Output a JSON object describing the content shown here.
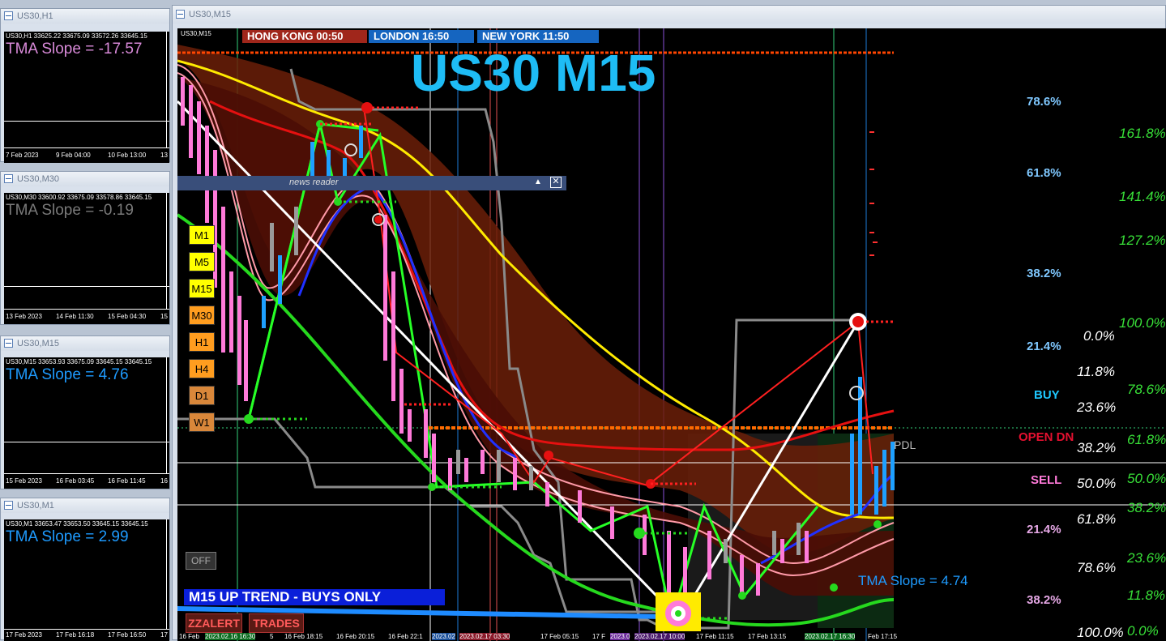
{
  "side_windows": [
    {
      "title": "US30,H1",
      "header": "US30,H1  33625.22 33675.09 33572.26 33645.15",
      "slope": "TMA Slope = -17.57",
      "slope_color": "#d98ad9",
      "dates": [
        "7 Feb 2023",
        "9 Feb 04:00",
        "10 Feb 13:00",
        "13"
      ]
    },
    {
      "title": "US30,M30",
      "header": "US30,M30  33600.92 33675.09 33578.86 33645.15",
      "slope": "TMA Slope = -0.19",
      "slope_color": "#7a7a7a",
      "dates": [
        "13 Feb 2023",
        "14 Feb 11:30",
        "15 Feb 04:30",
        "15"
      ]
    },
    {
      "title": "US30,M15",
      "header": "US30,M15  33653.93 33675.09 33645.15 33645.15",
      "slope": "TMA Slope = 4.76",
      "slope_color": "#1e9bff",
      "dates": [
        "15 Feb 2023",
        "16 Feb 03:45",
        "16 Feb 11:45",
        "16"
      ]
    },
    {
      "title": "US30,M1",
      "header": "US30,M1  33653.47 33653.50 33645.15 33645.15",
      "slope": "TMA Slope = 2.99",
      "slope_color": "#1e9bff",
      "dates": [
        "17 Feb 2023",
        "17 Feb 16:18",
        "17 Feb 16:50",
        "17"
      ]
    }
  ],
  "main": {
    "title": "US30,M15",
    "header": "US30,M15",
    "big_title": "US30 M15",
    "sessions": [
      {
        "label": "HONG KONG  00:50",
        "color": "#a0261b"
      },
      {
        "label": "LONDON   16:50",
        "color": "#1565c0"
      },
      {
        "label": "NEW YORK  11:50",
        "color": "#1565c0"
      }
    ],
    "news_reader": "news reader",
    "timeframes": [
      {
        "label": "M1",
        "color": "#ffff00"
      },
      {
        "label": "M5",
        "color": "#ffff00"
      },
      {
        "label": "M15",
        "color": "#ffff00"
      },
      {
        "label": "M30",
        "color": "#ff9d1f"
      },
      {
        "label": "H1",
        "color": "#ff9d1f"
      },
      {
        "label": "H4",
        "color": "#ff9d1f"
      },
      {
        "label": "D1",
        "color": "#d9873a"
      },
      {
        "label": "W1",
        "color": "#d9873a"
      }
    ],
    "off_button": "OFF",
    "trend_banner": "M15 UP TREND - BUYS ONLY",
    "zzalert": "ZZALERT",
    "trades": "TRADES",
    "slope_label": "TMA Slope = 4.74",
    "pdl": "PDL",
    "signals": {
      "buy": "BUY",
      "open_dn": "OPEN DN",
      "sell": "SELL"
    },
    "fib_blue": [
      "78.6%",
      "61.8%",
      "38.2%",
      "21.4%"
    ],
    "fib_pink": [
      "21.4%",
      "38.2%"
    ],
    "fib_green": [
      "161.8%",
      "141.4%",
      "127.2%",
      "100.0%",
      "78.6%",
      "61.8%",
      "50.0%",
      "38.2%",
      "23.6%",
      "11.8%",
      "0.0%"
    ],
    "fib_white": [
      "0.0%",
      "11.8%",
      "23.6%",
      "38.2%",
      "50.0%",
      "61.8%",
      "78.6%",
      "100.0%"
    ],
    "dates": [
      "16 Feb",
      "2023.02.16 16:30",
      "5",
      "16 Feb 18:15",
      "16 Feb 20:15",
      "16 Feb 22:1",
      "2023.02",
      "2023.02.17 03:30",
      "17 Feb 05:15",
      "17 F",
      "2023.0",
      "2023.02.17 10:00",
      "17 Feb 11:15",
      "17 Feb 13:15",
      "2023.02.17 16:30",
      "Feb 17:15"
    ]
  }
}
